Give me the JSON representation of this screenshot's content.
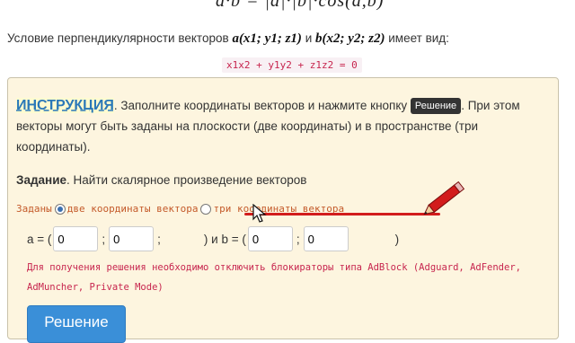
{
  "top_formula": "a·b = |a|·|b|·cos(a,b)",
  "condition": {
    "prefix": "Условие перпендикулярности векторов",
    "vec_a": "a(x1; y1; z1)",
    "conj": "и",
    "vec_b": "b(x2; y2; z2)",
    "suffix": "имеет вид:",
    "formula": "x1x2 + y1y2 + z1z2 = 0"
  },
  "instruction": {
    "title": "ИНСТРУКЦИЯ",
    "text1": ". Заполните координаты векторов и нажмите кнопку",
    "button_label": "Решение",
    "text2": ". При этом векторы могут быть заданы на плоскости (две координаты) и в пространстве (три координаты)."
  },
  "task": {
    "label": "Задание",
    "text": ". Найти скалярное произведение векторов"
  },
  "mode": {
    "prefix": "Заданы",
    "option1": "две координаты вектора",
    "option2": "три координаты вектора",
    "selected": "option1"
  },
  "vectors": {
    "a_label": "a = (",
    "a_x": "0",
    "a_y": "0",
    "sep": ";",
    "close_and": ") и b = (",
    "b_x": "0",
    "b_y": "0",
    "close": ")"
  },
  "note": "Для получения решения необходимо отключить блокираторы типа AdBlock (Adguard, AdFender, AdMuncher, Private Mode)",
  "solve_button": "Решение",
  "colors": {
    "panel_bg": "#fdf5df",
    "accent_blue": "#2a78b8",
    "code_pink": "#c7254e",
    "mode_orange": "#c45a2a",
    "annotation_red": "#d21c1c"
  },
  "icons": [
    "pencil-icon",
    "mouse-cursor-icon"
  ]
}
